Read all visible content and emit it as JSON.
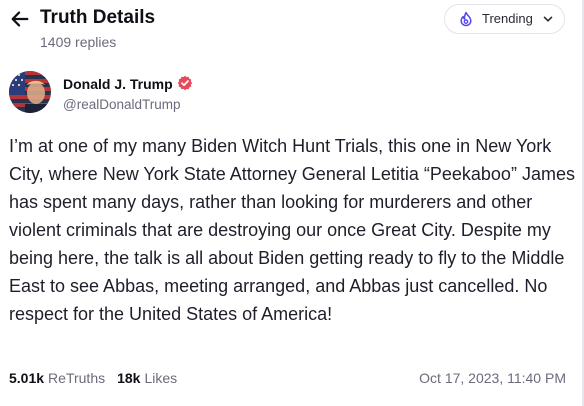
{
  "header": {
    "back_icon": "arrow-left-icon",
    "title": "Truth Details",
    "replies": "1409 replies",
    "sort": {
      "icon": "flame-icon",
      "label": "Trending",
      "chevron_icon": "chevron-down-icon"
    }
  },
  "post": {
    "author": {
      "name": "Donald J. Trump",
      "handle": "@realDonaldTrump",
      "verified_icon": "verified-badge-icon",
      "verified_color": "#e44b5b"
    },
    "text": "I’m at one of my many Biden Witch Hunt Trials, this one in New York City, where New York State Attorney General Letitia “Peekaboo” James has spent many days, rather than looking for murderers and other violent criminals that are destroying our once Great City. Despite my being here, the talk is all about Biden getting ready to fly to the Middle East to see Abbas, meeting arranged, and Abbas just cancelled. No respect for the United States of America!",
    "stats": {
      "retruths_count": "5.01k",
      "retruths_label": "ReTruths",
      "likes_count": "18k",
      "likes_label": "Likes"
    },
    "timestamp": "Oct 17, 2023, 11:40 PM"
  },
  "colors": {
    "accent": "#5448ee",
    "muted": "#6b6b7b",
    "text": "#0f0f16"
  }
}
